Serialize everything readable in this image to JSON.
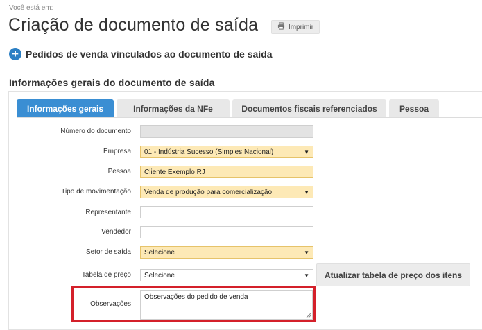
{
  "breadcrumb": "Você está em:",
  "page_title": "Criação de documento de saída",
  "print_button": {
    "label": "Imprimir",
    "icon": "printer-icon"
  },
  "linked_orders": {
    "label": "Pedidos de venda vinculados ao documento de saída",
    "icon": "plus-circle-icon"
  },
  "section_title": "Informações gerais do documento de saída",
  "tabs": [
    {
      "label": "Informações gerais",
      "active": true
    },
    {
      "label": "Informações da NFe",
      "active": false
    },
    {
      "label": "Documentos fiscais referenciados",
      "active": false
    },
    {
      "label": "Pessoa",
      "active": false
    }
  ],
  "form": {
    "numero_documento": {
      "label": "Número do documento",
      "value": ""
    },
    "empresa": {
      "label": "Empresa",
      "value": "01 - Indústria Sucesso (Simples Nacional)"
    },
    "pessoa": {
      "label": "Pessoa",
      "value": "Cliente Exemplo RJ"
    },
    "tipo_movimentacao": {
      "label": "Tipo de movimentação",
      "value": "Venda de produção para comercialização"
    },
    "representante": {
      "label": "Representante",
      "value": ""
    },
    "vendedor": {
      "label": "Vendedor",
      "value": ""
    },
    "setor_saida": {
      "label": "Setor de saída",
      "value": "Selecione"
    },
    "tabela_preco": {
      "label": "Tabela de preço",
      "value": "Selecione"
    },
    "observacoes": {
      "label": "Observações",
      "value": "Observações do pedido de venda"
    }
  },
  "update_price_button": "Atualizar tabela de preço dos itens",
  "colors": {
    "accent": "#3a8ed3",
    "required_field_bg": "#fde9b6",
    "highlight_border": "#d4202a",
    "disabled_field_bg": "#e3e3e3"
  }
}
